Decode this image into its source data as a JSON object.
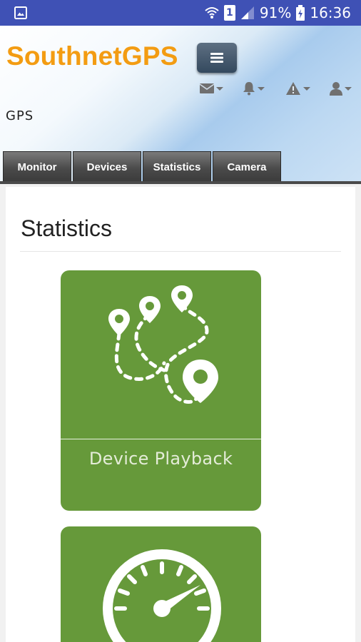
{
  "status_bar": {
    "left_icon": "gallery-icon",
    "right_icons": [
      "wifi-icon",
      "sim-icon",
      "signal-icon"
    ],
    "sim_number": "1",
    "battery": "91%",
    "battery_icon": "battery-charging-icon",
    "time": "16:36",
    "color": "#3f51b5"
  },
  "header": {
    "brand": "SouthnetGPS",
    "brand_color": "#f39c12",
    "menu_icon": "hamburger-menu-icon",
    "toolbar": [
      {
        "icon": "envelope-icon"
      },
      {
        "icon": "bell-icon"
      },
      {
        "icon": "warning-icon"
      },
      {
        "icon": "user-icon"
      }
    ],
    "subtitle": "GPS"
  },
  "tabs": [
    {
      "label": "Monitor"
    },
    {
      "label": "Devices"
    },
    {
      "label": "Statistics"
    },
    {
      "label": "Camera"
    }
  ],
  "main": {
    "title": "Statistics",
    "cards": [
      {
        "label": "Device Playback",
        "icon": "route-playback-icon"
      },
      {
        "label": "",
        "icon": "speedometer-icon"
      }
    ],
    "card_color": "#66993a"
  }
}
